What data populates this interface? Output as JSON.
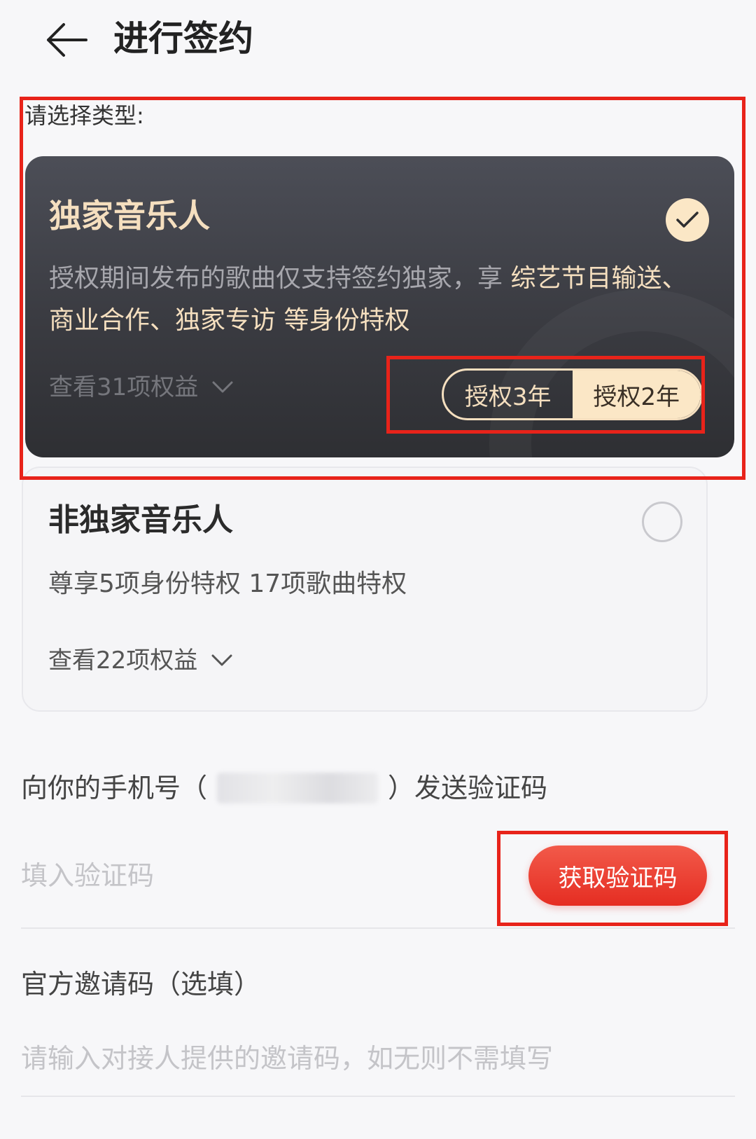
{
  "header": {
    "title": "进行签约"
  },
  "section_label": "请选择类型:",
  "exclusive_card": {
    "title": "独家音乐人",
    "desc_plain": "授权期间发布的歌曲仅支持签约独家，享 ",
    "desc_highlight": "综艺节目输送、商业合作、独家专访",
    "desc_tail": " 等身份特权",
    "view_benefits": "查看31项权益",
    "selected": true,
    "term_options": [
      "授权3年",
      "授权2年"
    ],
    "term_selected": "授权2年"
  },
  "nonexclusive_card": {
    "title": "非独家音乐人",
    "desc": "尊享5项身份特权 17项歌曲特权",
    "view_benefits": "查看22项权益",
    "selected": false
  },
  "verification": {
    "phone_prefix": "向你的手机号（",
    "phone_suffix": "）发送验证码",
    "code_placeholder": "填入验证码",
    "get_code_label": "获取验证码"
  },
  "invite": {
    "label": "官方邀请码（选填）",
    "placeholder": "请输入对接人提供的邀请码，如无则不需填写"
  },
  "colors": {
    "accent_red": "#e52d22",
    "gold": "#f5dfbf",
    "card_dark": "#3a3b41"
  }
}
